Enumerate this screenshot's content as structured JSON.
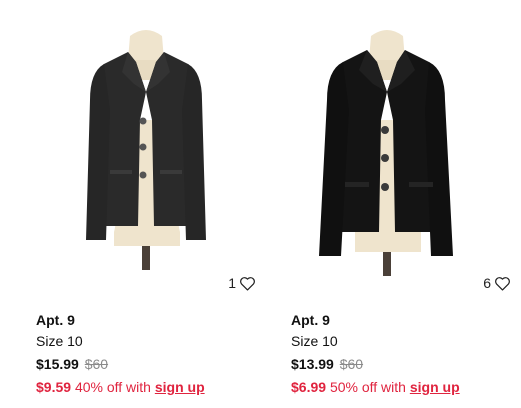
{
  "colors": {
    "promo": "#e0243f",
    "strike": "#8a8a8a"
  },
  "products": [
    {
      "brand": "Apt. 9",
      "size": "Size 10",
      "price": "$15.99",
      "original_price": "$60",
      "promo_price": "$9.59",
      "promo_text": "40% off with",
      "signup_label": "sign up",
      "likes": "1",
      "like_icon": "heart-outline-icon"
    },
    {
      "brand": "Apt. 9",
      "size": "Size 10",
      "price": "$13.99",
      "original_price": "$60",
      "promo_price": "$6.99",
      "promo_text": "50% off with",
      "signup_label": "sign up",
      "likes": "6",
      "like_icon": "heart-outline-icon"
    }
  ]
}
